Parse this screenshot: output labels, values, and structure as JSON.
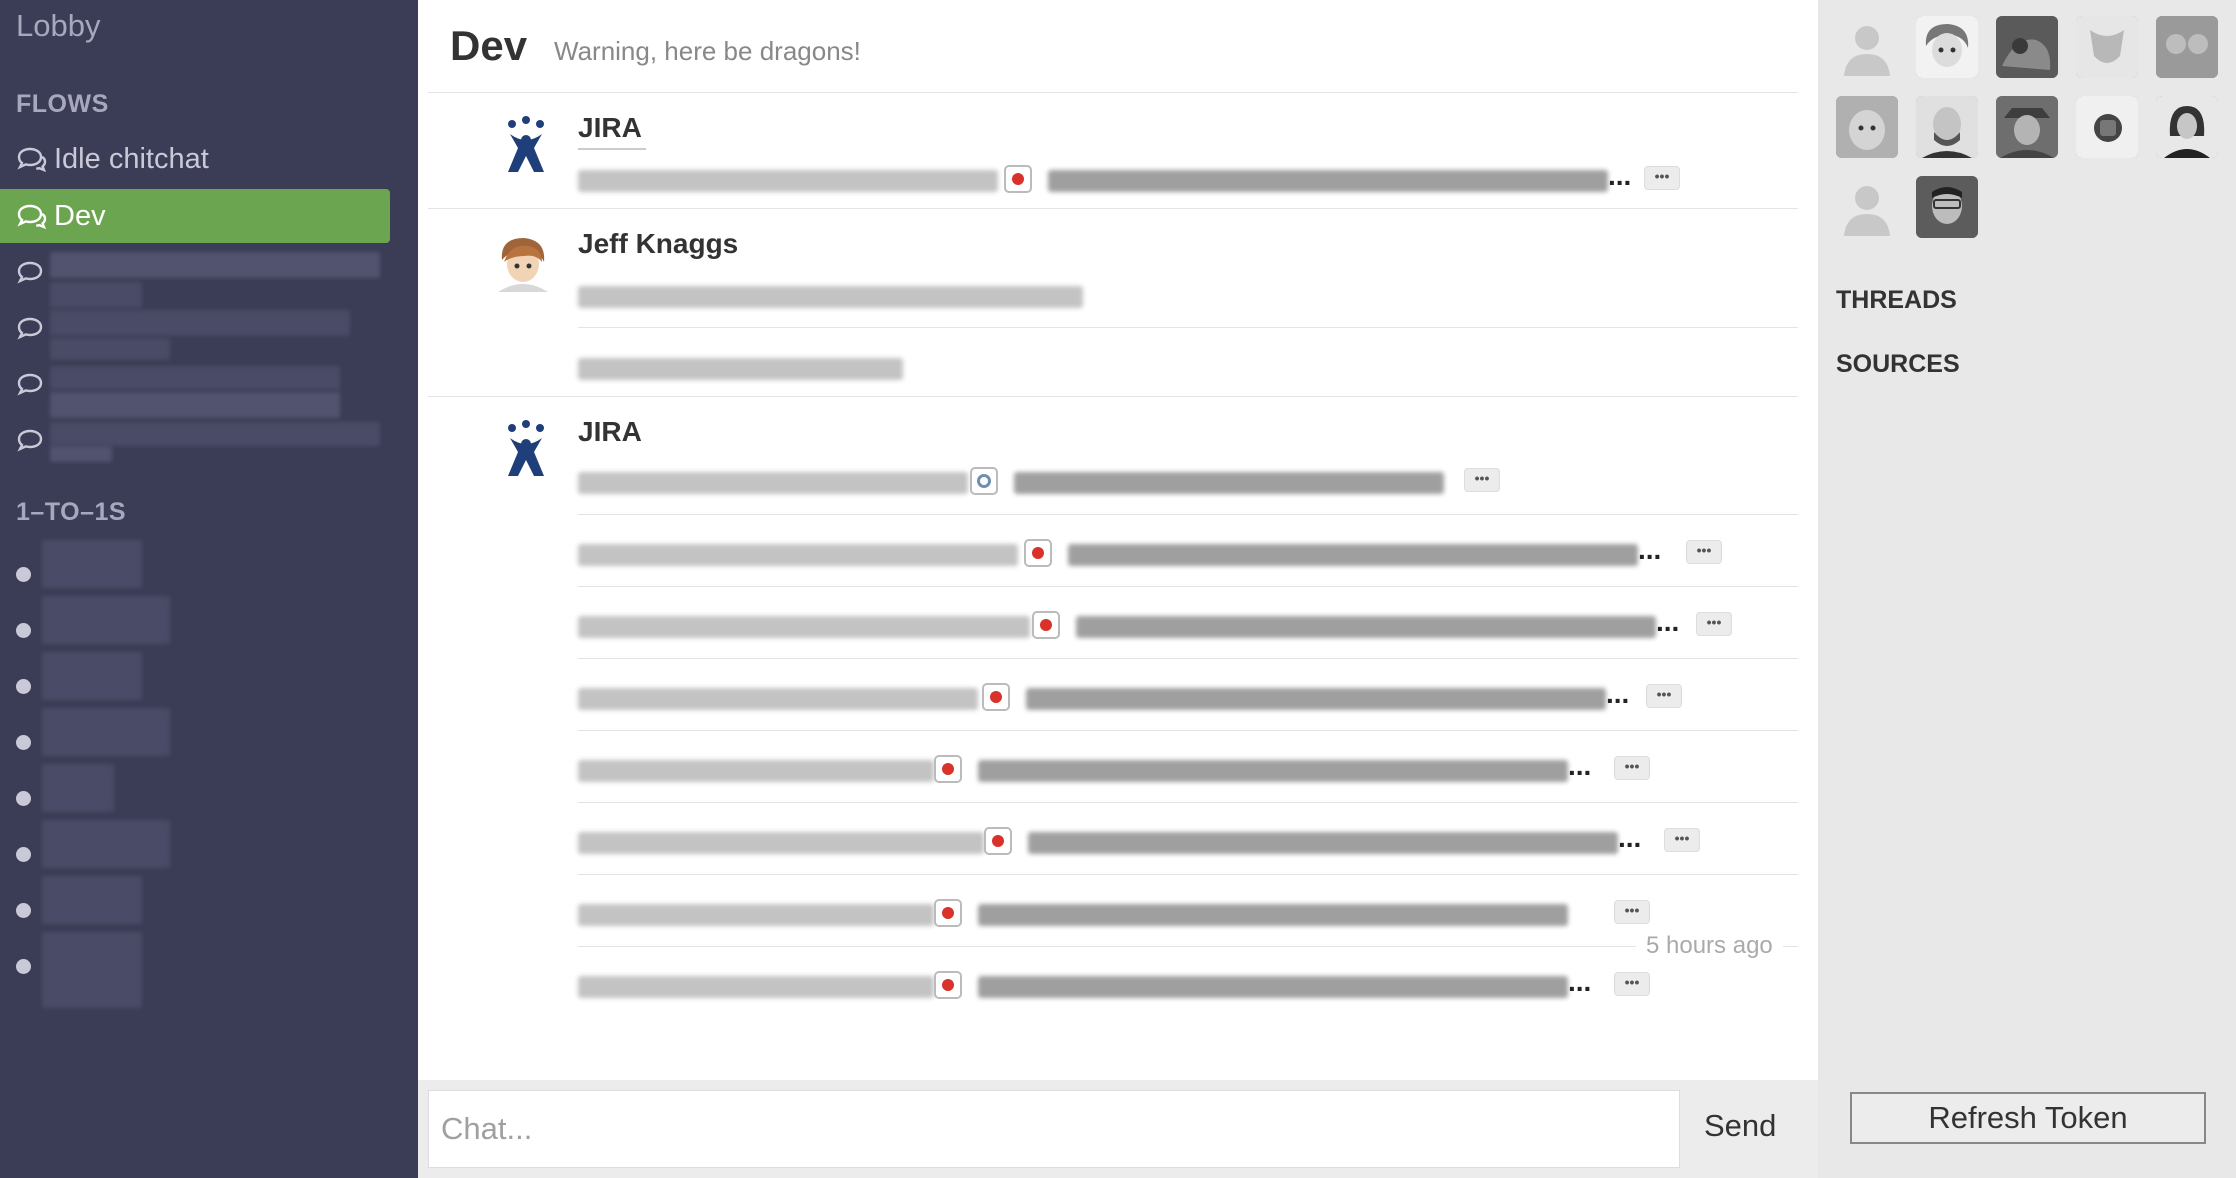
{
  "sidebar": {
    "lobby_label": "Lobby",
    "flows_heading": "FLOWS",
    "flows": [
      {
        "label": "Idle chitchat",
        "active": false
      },
      {
        "label": "Dev",
        "active": true
      }
    ],
    "one_to_ones_heading": "1–TO–1S"
  },
  "header": {
    "title": "Dev",
    "subtitle": "Warning, here be dragons!"
  },
  "messages": {
    "jira_author": "JIRA",
    "jeff_author": "Jeff Knaggs",
    "ellipsis": "...",
    "more_glyph": "•••",
    "timestamp": "5 hours ago"
  },
  "composer": {
    "placeholder": "Chat...",
    "send_label": "Send"
  },
  "right_panel": {
    "threads_label": "THREADS",
    "sources_label": "SOURCES",
    "refresh_label": "Refresh Token"
  },
  "colors": {
    "sidebar_bg": "#3b3c55",
    "active_flow": "#6ba54f",
    "jira_blue": "#1e3f7a",
    "issue_red": "#d9322a"
  },
  "icons": {
    "flow": "chat-bubble-icon",
    "jira": "jira-logo-icon",
    "issue": "issue-type-icon",
    "member_default": "default-user-icon"
  }
}
